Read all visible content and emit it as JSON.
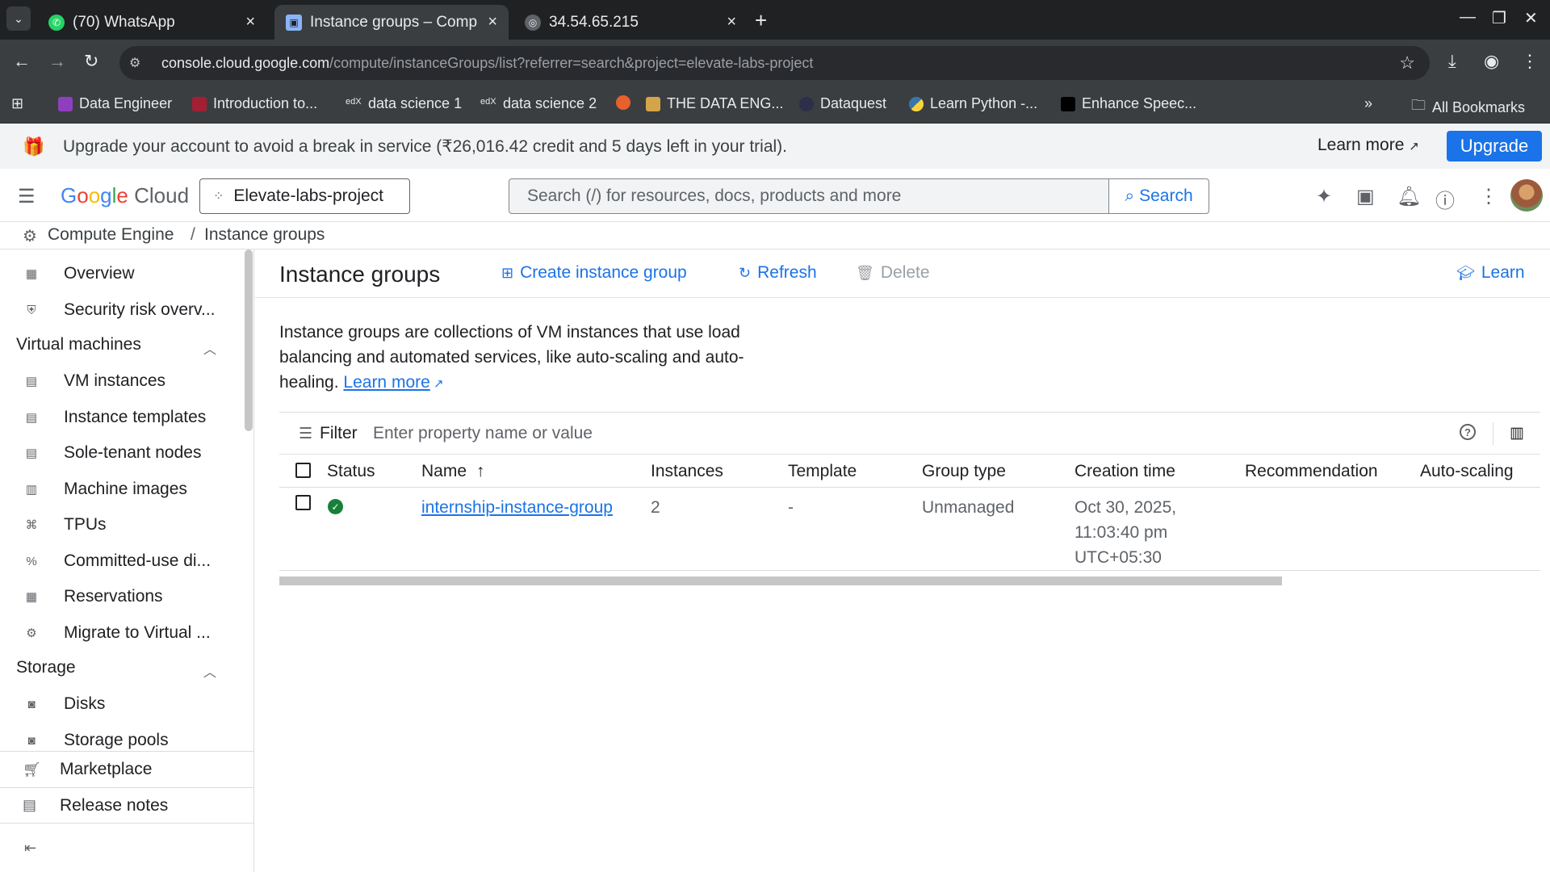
{
  "browser": {
    "tabs": [
      {
        "title": "(70) WhatsApp",
        "active": false
      },
      {
        "title": "Instance groups – Comp",
        "active": true
      },
      {
        "title": "34.54.65.215",
        "active": false
      }
    ],
    "url_host": "console.cloud.google.com",
    "url_path": "/compute/instanceGroups/list?referrer=search&project=elevate-labs-project",
    "bookmarks": [
      "Data Engineer",
      "Introduction to...",
      "data science 1",
      "data science 2",
      "THE DATA ENG...",
      "Dataquest",
      "Learn Python -...",
      "Enhance Speec..."
    ],
    "all_bookmarks": "All Bookmarks"
  },
  "banner": {
    "message": "Upgrade your account to avoid a break in service (₹26,016.42 credit and 5 days left in your trial).",
    "learn_more": "Learn more",
    "upgrade": "Upgrade"
  },
  "header": {
    "logo_google": "Google",
    "logo_cloud": "Cloud",
    "project": "Elevate-labs-project",
    "search_placeholder": "Search (/) for resources, docs, products and more",
    "search_button": "Search"
  },
  "breadcrumb": {
    "section": "Compute Engine",
    "separator": "/",
    "page": "Instance groups"
  },
  "sidebar": {
    "top_items": [
      {
        "label": "Overview",
        "icon": "dashboard-icon"
      },
      {
        "label": "Security risk overv...",
        "icon": "shield-icon"
      }
    ],
    "vm_section": "Virtual machines",
    "vm_items": [
      {
        "label": "VM instances",
        "icon": "server-icon"
      },
      {
        "label": "Instance templates",
        "icon": "template-icon"
      },
      {
        "label": "Sole-tenant nodes",
        "icon": "node-icon"
      },
      {
        "label": "Machine images",
        "icon": "image-icon"
      },
      {
        "label": "TPUs",
        "icon": "tpu-icon"
      },
      {
        "label": "Committed-use di...",
        "icon": "percent-icon"
      },
      {
        "label": "Reservations",
        "icon": "calendar-icon"
      },
      {
        "label": "Migrate to Virtual ...",
        "icon": "migrate-icon"
      }
    ],
    "storage_section": "Storage",
    "storage_items": [
      {
        "label": "Disks",
        "icon": "disk-icon"
      },
      {
        "label": "Storage pools",
        "icon": "storage-pool-icon"
      }
    ],
    "marketplace": "Marketplace",
    "release_notes": "Release notes"
  },
  "main": {
    "title": "Instance groups",
    "actions": {
      "create": "Create instance group",
      "refresh": "Refresh",
      "delete": "Delete",
      "learn": "Learn"
    },
    "description": "Instance groups are collections of VM instances that use load balancing and automated services, like auto-scaling and auto-healing.",
    "description_link": "Learn more",
    "filter_label": "Filter",
    "filter_placeholder": "Enter property name or value",
    "columns": {
      "status": "Status",
      "name": "Name",
      "sort_arrow": "↑",
      "instances": "Instances",
      "template": "Template",
      "group_type": "Group type",
      "creation_time": "Creation time",
      "recommendation": "Recommendation",
      "autoscaling": "Auto-scaling"
    },
    "rows": [
      {
        "status": "ok",
        "name": "internship-instance-group",
        "instances": "2",
        "template": "-",
        "group_type": "Unmanaged",
        "creation_line1": "Oct 30, 2025,",
        "creation_line2": "11:03:40 pm",
        "creation_line3": "UTC+05:30"
      }
    ]
  },
  "colors": {
    "accent": "#1a73e8",
    "status_ok": "#188038",
    "chrome_dark": "#1f2123"
  }
}
